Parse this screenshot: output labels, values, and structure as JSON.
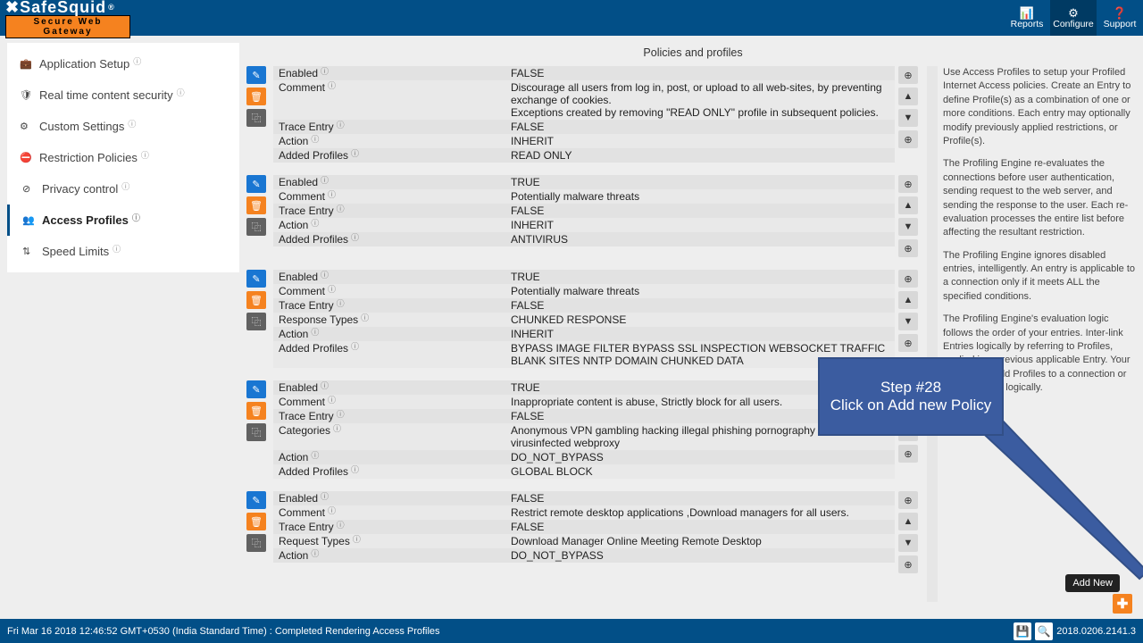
{
  "brand": {
    "name": "SafeSquid",
    "x": "✖",
    "r": "®",
    "sub": "Secure Web Gateway"
  },
  "topnav": [
    {
      "icon": "📊",
      "label": "Reports"
    },
    {
      "icon": "⚙",
      "label": "Configure",
      "active": true
    },
    {
      "icon": "❓",
      "label": "Support"
    }
  ],
  "sidebar": [
    {
      "icon": "💼",
      "label": "Application Setup",
      "info": true
    },
    {
      "icon": "🛡",
      "label": "Real time content security",
      "info": true
    },
    {
      "icon": "⚙",
      "label": "Custom Settings",
      "info": true
    },
    {
      "icon": "⛔",
      "label": "Restriction Policies",
      "info": true
    },
    {
      "icon": "⊘",
      "label": "Privacy control",
      "info": true,
      "level": 2
    },
    {
      "icon": "👥",
      "label": "Access Profiles",
      "info": true,
      "level": 2,
      "active": true
    },
    {
      "icon": "⇅",
      "label": "Speed Limits",
      "info": true,
      "level": 2
    }
  ],
  "content_title": "Policies and profiles",
  "policies": [
    {
      "rows": [
        {
          "k": "Enabled",
          "v": "FALSE"
        },
        {
          "k": "Comment",
          "v": "Discourage all users from log in, post, or upload to all web-sites, by preventing exchange of cookies.\nExceptions created by removing \"READ ONLY\" profile in subsequent policies."
        },
        {
          "k": "Trace Entry",
          "v": "FALSE"
        },
        {
          "k": "Action",
          "v": "INHERIT"
        },
        {
          "k": "Added Profiles",
          "v": "READ ONLY"
        }
      ],
      "side": [
        "⊕",
        "▲",
        "▼",
        "⊕"
      ]
    },
    {
      "rows": [
        {
          "k": "Enabled",
          "v": "TRUE"
        },
        {
          "k": "Comment",
          "v": "Potentially malware threats"
        },
        {
          "k": "Trace Entry",
          "v": "FALSE"
        },
        {
          "k": "Action",
          "v": "INHERIT"
        },
        {
          "k": "Added Profiles",
          "v": "ANTIVIRUS"
        }
      ],
      "side": [
        "⊕",
        "▲",
        "▼",
        "⊕"
      ]
    },
    {
      "rows": [
        {
          "k": "Enabled",
          "v": "TRUE"
        },
        {
          "k": "Comment",
          "v": "Potentially malware threats"
        },
        {
          "k": "Trace Entry",
          "v": "FALSE"
        },
        {
          "k": "Response Types",
          "v": "CHUNKED RESPONSE"
        },
        {
          "k": "Action",
          "v": "INHERIT"
        },
        {
          "k": "Added Profiles",
          "v": "BYPASS IMAGE FILTER   BYPASS SSL INSPECTION   WEBSOCKET TRAFFIC   BLANK SITES   NNTP DOMAIN   CHUNKED DATA"
        }
      ],
      "side": [
        "⊕",
        "▲",
        "▼",
        "⊕"
      ]
    },
    {
      "rows": [
        {
          "k": "Enabled",
          "v": "TRUE"
        },
        {
          "k": "Comment",
          "v": "Inappropriate content is abuse, Strictly block for all users."
        },
        {
          "k": "Trace Entry",
          "v": "FALSE"
        },
        {
          "k": "Categories",
          "v": "Anonymous VPN   gambling   hacking   illegal   phishing   pornography   violence   virusinfected   webproxy"
        },
        {
          "k": "Action",
          "v": "DO_NOT_BYPASS"
        },
        {
          "k": "Added Profiles",
          "v": "GLOBAL BLOCK"
        }
      ],
      "side": [
        "⊕",
        "▲",
        "▼",
        "⊕"
      ]
    },
    {
      "rows": [
        {
          "k": "Enabled",
          "v": "FALSE"
        },
        {
          "k": "Comment",
          "v": "Restrict remote desktop applications ,Download managers for all users."
        },
        {
          "k": "Trace Entry",
          "v": "FALSE"
        },
        {
          "k": "Request Types",
          "v": "Download Manager   Online Meeting   Remote Desktop"
        },
        {
          "k": "Action",
          "v": "DO_NOT_BYPASS"
        }
      ],
      "side": [
        "⊕",
        "▲",
        "▼",
        "⊕"
      ]
    }
  ],
  "desc": [
    "Use Access Profiles to setup your Profiled Internet Access policies. Create an Entry to define Profile(s) as a combination of one or more conditions. Each entry may optionally modify previously applied restrictions, or Profile(s).",
    "The Profiling Engine re-evaluates the connections before user authentication, sending request to the web server, and sending the response to the user. Each re-evaluation processes the entire list before affecting the resultant restriction.",
    "The Profiling Engine ignores disabled entries, intelligently. An entry is applicable to a connection only if it meets ALL the specified conditions.",
    "The Profiling Engine's evaluation logic follows the order of your entries. Inter-link Entries logically by referring to Profiles, applied in a previous applicable Entry. Your entries can add Profiles to a connection or remove them, logically."
  ],
  "tooltip": "Add New",
  "callout": {
    "title": "Step #28",
    "text": "Click on Add new Policy"
  },
  "status": {
    "left": "Fri Mar 16 2018 12:46:52 GMT+0530 (India Standard Time) : Completed Rendering Access Profiles",
    "right": "2018.0206.2141.3"
  },
  "icons": {
    "save": "💾",
    "search": "🔍",
    "plus": "✚",
    "edit": "✎",
    "del": "🗑",
    "copy": "⿻",
    "info": "ⓘ"
  }
}
